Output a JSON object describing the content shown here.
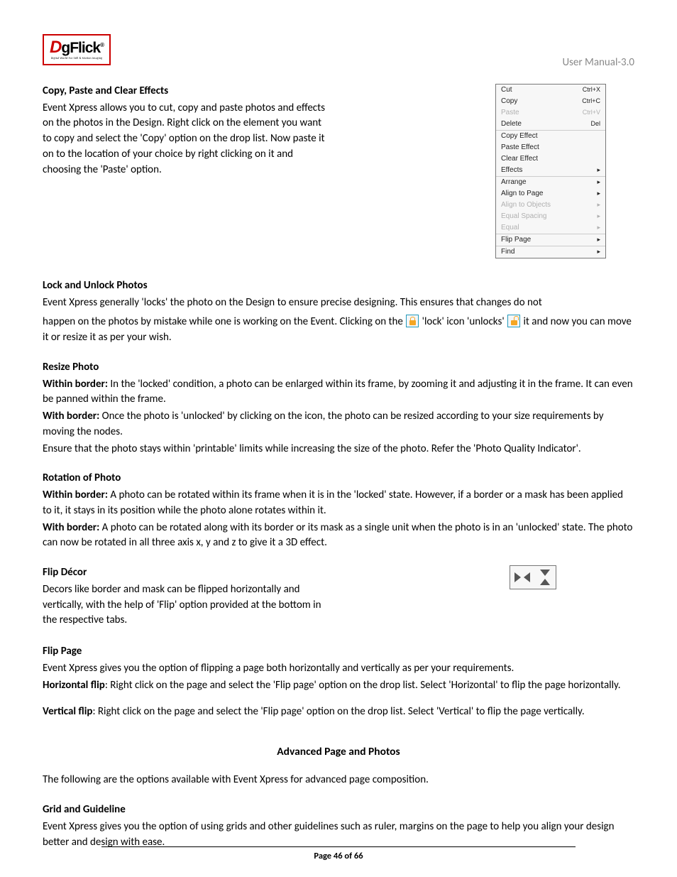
{
  "header": {
    "logo_main_d": "D",
    "logo_main_rest": "gFlick",
    "logo_sub": "Digital World For Still & Motion Imaging",
    "logo_reg": "®",
    "manual_label": "User Manual-3.0"
  },
  "sections": {
    "copy_effects": {
      "title": "Copy, Paste and Clear Effects",
      "body": "Event Xpress allows you to cut, copy and paste photos and effects on the photos in the Design. Right click on the element you want to copy and select the 'Copy' option on the drop list. Now paste it on to the location of your choice by right clicking on it and choosing the 'Paste' option."
    },
    "lock_unlock": {
      "title": "Lock and Unlock Photos",
      "line1": "Event Xpress generally 'locks' the photo on the Design to ensure precise designing. This ensures that changes do not",
      "line2_a": "happen on the photos by mistake while one is working on the Event. Clicking on the ",
      "line2_b": " 'lock' icon 'unlocks' ",
      "line2_c": " it and now you can move it or resize it as per your wish."
    },
    "resize": {
      "title": "Resize Photo",
      "within_label": "Within border:",
      "within_body": " In the 'locked' condition, a photo can be enlarged within its frame, by zooming it and adjusting it in the frame. It can even be panned within the frame.",
      "with_label": "With border:",
      "with_body": " Once the photo is 'unlocked' by clicking on the icon, the photo can be resized according to your size requirements by moving the nodes.",
      "ensure": "Ensure that the photo stays within 'printable' limits while increasing the size of the photo. Refer the 'Photo Quality Indicator'."
    },
    "rotation": {
      "title": "Rotation of Photo",
      "within_label": "Within border:",
      "within_body": " A photo can be rotated within its frame when it is in the 'locked' state. However, if a border or a mask has been applied to it, it stays in its position while the photo alone rotates within it.",
      "with_label": "With border:",
      "with_body": " A photo can be rotated along with its border or its mask as a single unit when the photo is in an 'unlocked' state. The photo can now be rotated in all three axis x, y and z to give it a 3D effect."
    },
    "flip_decor": {
      "title": "Flip Décor",
      "body": "Decors like border and mask can be flipped horizontally and vertically, with the help of 'Flip' option provided at the bottom in the respective tabs."
    },
    "flip_page": {
      "title": "Flip Page",
      "intro": "Event Xpress gives you the option of flipping a page both horizontally and vertically as per your requirements.",
      "h_label": "Horizontal flip",
      "h_body": ": Right click on the page and select the 'Flip page' option on the drop list. Select 'Horizontal' to flip the page horizontally.",
      "v_label": "Vertical flip",
      "v_body": ": Right click on the page and select the 'Flip page' option on the drop list. Select 'Vertical' to flip the page vertically."
    },
    "advanced": {
      "title": "Advanced Page and Photos",
      "intro": "The following are the options available with Event Xpress for advanced page composition."
    },
    "grid": {
      "title": "Grid and Guideline",
      "body": "Event Xpress gives you the option of using grids and other guidelines such as ruler, margins on the page to help you align your design better and design with ease."
    }
  },
  "context_menu": [
    {
      "label": "Cut",
      "shortcut": "Ctrl+X",
      "arrow": false,
      "disabled": false
    },
    {
      "label": "Copy",
      "shortcut": "Ctrl+C",
      "arrow": false,
      "disabled": false
    },
    {
      "label": "Paste",
      "shortcut": "Ctrl+V",
      "arrow": false,
      "disabled": true
    },
    {
      "label": "Delete",
      "shortcut": "Del",
      "arrow": false,
      "disabled": false
    },
    {
      "sep": true
    },
    {
      "label": "Copy Effect",
      "shortcut": "",
      "arrow": false,
      "disabled": false
    },
    {
      "label": "Paste Effect",
      "shortcut": "",
      "arrow": false,
      "disabled": false
    },
    {
      "label": "Clear Effect",
      "shortcut": "",
      "arrow": false,
      "disabled": false
    },
    {
      "label": "Effects",
      "shortcut": "",
      "arrow": true,
      "disabled": false
    },
    {
      "sep": true
    },
    {
      "label": "Arrange",
      "shortcut": "",
      "arrow": true,
      "disabled": false
    },
    {
      "label": "Align to Page",
      "shortcut": "",
      "arrow": true,
      "disabled": false
    },
    {
      "label": "Align to Objects",
      "shortcut": "",
      "arrow": true,
      "disabled": true
    },
    {
      "label": "Equal Spacing",
      "shortcut": "",
      "arrow": true,
      "disabled": true
    },
    {
      "label": "Equal",
      "shortcut": "",
      "arrow": true,
      "disabled": true
    },
    {
      "sep": true
    },
    {
      "label": "Flip Page",
      "shortcut": "",
      "arrow": true,
      "disabled": false
    },
    {
      "sep": true
    },
    {
      "label": "Find",
      "shortcut": "",
      "arrow": true,
      "disabled": false
    }
  ],
  "footer": {
    "page_text": "Page 46 of 66"
  }
}
